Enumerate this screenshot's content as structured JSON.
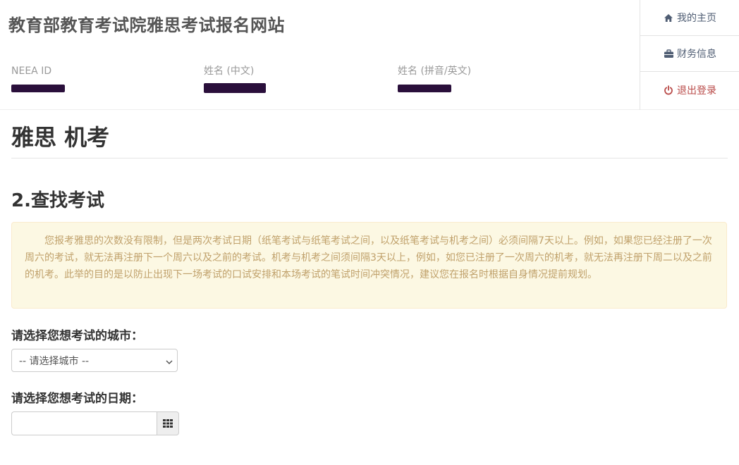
{
  "header": {
    "site_title": "教育部教育考试院雅思考试报名网站",
    "info": {
      "neea_id_label": "NEEA ID",
      "name_cn_label": "姓名 (中文)",
      "name_en_label": "姓名 (拼音/英文)"
    }
  },
  "nav": {
    "items": [
      {
        "label": "我的主页",
        "icon": "home-icon"
      },
      {
        "label": "财务信息",
        "icon": "briefcase-icon"
      },
      {
        "label": "退出登录",
        "icon": "power-icon"
      }
    ]
  },
  "main": {
    "page_title": "雅思 机考",
    "step_title": "2.查找考试",
    "notice": "您报考雅思的次数没有限制，但是两次考试日期（纸笔考试与纸笔考试之间，以及纸笔考试与机考之间）必须间隔7天以上。例如，如果您已经注册了一次周六的考试，就无法再注册下一个周六以及之前的考试。机考与机考之间须间隔3天以上，例如，如您已注册了一次周六的机考，就无法再注册下周二以及之前的机考。此举的目的是以防止出现下一场考试的口试安排和本场考试的笔试时间冲突情况，建议您在报名时根据自身情况提前规划。",
    "city_label": "请选择您想考试的城市：",
    "city_select": {
      "selected": "-- 请选择城市 --"
    },
    "date_label": "请选择您想考试的日期：",
    "date_input": {
      "value": "",
      "placeholder": ""
    }
  },
  "colors": {
    "notice_bg": "#fcf8e3",
    "notice_text": "#c0a16b",
    "logout": "#b94a48",
    "nav_text": "#4f5d73",
    "redaction": "#2a0f3b"
  }
}
